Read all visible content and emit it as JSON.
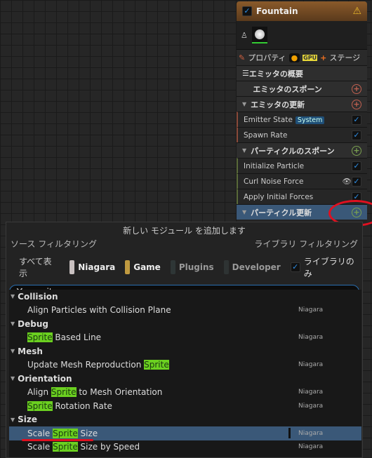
{
  "emitter": {
    "title": "Fountain",
    "tabs": {
      "properties": "プロパティ",
      "gpu": "GPU",
      "stage": "ステージ"
    },
    "rows": [
      {
        "label": "エミッタの概要",
        "type": "section"
      },
      {
        "label": "エミッタのスポーン",
        "type": "section",
        "add": true
      },
      {
        "label": "エミッタの更新",
        "type": "section",
        "add": true,
        "expanded": true
      },
      {
        "label": "Emitter State",
        "badge": "System",
        "type": "module",
        "checked": true
      },
      {
        "label": "Spawn Rate",
        "type": "module",
        "checked": true
      },
      {
        "label": "パーティクルのスポーン",
        "type": "section",
        "add": true,
        "expanded": true
      },
      {
        "label": "Initialize Particle",
        "type": "module",
        "checked": true
      },
      {
        "label": "Curl Noise Force",
        "type": "module",
        "checked": true
      },
      {
        "label": "Apply Initial Forces",
        "type": "module",
        "checked": true
      },
      {
        "label": "パーティクル更新",
        "type": "section",
        "add": true,
        "expanded": true,
        "selected": true
      }
    ]
  },
  "popup": {
    "title": "新しい モジュール を追加します",
    "source_filter": "ソース フィルタリング",
    "library_filter": "ライブラリ フィルタリング",
    "show_all": "すべて表示",
    "chips": [
      {
        "label": "Niagara",
        "color": "#c8c0c0"
      },
      {
        "label": "Game",
        "color": "#c09a40"
      },
      {
        "label": "Plugins",
        "color": "#2e3636"
      },
      {
        "label": "Developer",
        "color": "#2e3333"
      }
    ],
    "library_only": "ライブラリのみ",
    "library_only_checked": true,
    "search_value": "sprite",
    "groups": [
      {
        "name": "Collision",
        "items": [
          {
            "pre": "Align Particles with Collision Plane",
            "hl": "",
            "post": "",
            "source": "Niagara"
          }
        ]
      },
      {
        "name": "Debug",
        "items": [
          {
            "pre": "",
            "hl": "Sprite",
            "post": " Based Line",
            "source": "Niagara"
          }
        ]
      },
      {
        "name": "Mesh",
        "items": [
          {
            "pre": "Update Mesh Reproduction ",
            "hl": "Sprite",
            "post": "",
            "source": "Niagara"
          }
        ]
      },
      {
        "name": "Orientation",
        "items": [
          {
            "pre": "Align ",
            "hl": "Sprite",
            "post": " to Mesh Orientation",
            "source": "Niagara"
          },
          {
            "pre": "",
            "hl": "Sprite",
            "post": " Rotation Rate",
            "source": "Niagara"
          }
        ]
      },
      {
        "name": "Size",
        "items": [
          {
            "pre": "Scale ",
            "hl": "Sprite",
            "post": " Size",
            "source": "Niagara",
            "selected": true
          },
          {
            "pre": "Scale ",
            "hl": "Sprite",
            "post": " Size by Speed",
            "source": "Niagara"
          }
        ]
      }
    ]
  }
}
